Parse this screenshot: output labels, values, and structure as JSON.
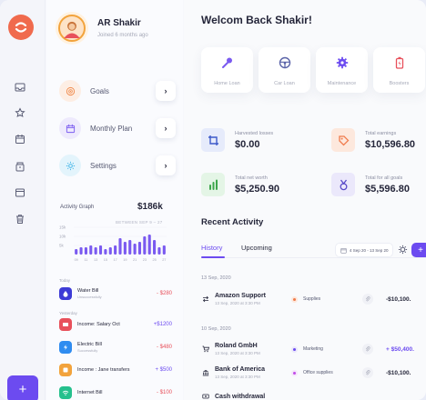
{
  "profile": {
    "name": "AR Shakir",
    "joined": "Joined 6 months ago",
    "avatar_icon": "user-avatar"
  },
  "menu": [
    {
      "label": "Goals",
      "icon": "target-icon",
      "color": "#f08a4b",
      "bg": "#fdeee4"
    },
    {
      "label": "Monthly Plan",
      "icon": "calendar-icon",
      "color": "#7a5af0",
      "bg": "#eeeafd"
    },
    {
      "label": "Settings",
      "icon": "gear-icon",
      "color": "#3fb4e8",
      "bg": "#e3f4fc"
    }
  ],
  "activity_graph": {
    "title": "Activity Graph",
    "value": "$186k",
    "range_label": "BETWEEN SEP 9 – 27"
  },
  "chart_data": {
    "type": "bar",
    "yticks": [
      "15k",
      "10k",
      "5k"
    ],
    "categories": [
      "09",
      "10",
      "11",
      "12",
      "13",
      "14",
      "15",
      "16",
      "17",
      "18",
      "19",
      "20",
      "21",
      "22",
      "23",
      "24",
      "25",
      "26",
      "27"
    ],
    "xticks_shown": [
      "09",
      "11",
      "13",
      "15",
      "17",
      "19",
      "21",
      "23",
      "25",
      "27"
    ],
    "values": [
      3,
      4,
      4,
      5,
      4,
      5,
      3,
      4,
      5,
      9,
      7,
      8,
      6,
      7,
      10,
      11,
      8,
      4,
      5
    ],
    "color": "#7a5af0"
  },
  "side_sections": {
    "today": "Today",
    "yesterday": "Yesterday"
  },
  "side_transactions": [
    {
      "name": "Water Bill",
      "sub": "Unsuccessfully",
      "amount": "- $280",
      "icon": "water-drop-icon",
      "icon_bg": "#3d3bd6",
      "amount_color": "#e8505b"
    },
    {
      "name": "Income: Salary Oct",
      "sub": "",
      "amount": "+$1200",
      "icon": "salary-icon",
      "icon_bg": "#e8505b",
      "amount_color": "#6c4bf0"
    },
    {
      "name": "Electric Bill",
      "sub": "Successfully",
      "amount": "- $480",
      "icon": "lightning-icon",
      "icon_bg": "#2f8cf0",
      "amount_color": "#e8505b"
    },
    {
      "name": "Income : Jane transfers",
      "sub": "",
      "amount": "+ $500",
      "icon": "transfer-icon",
      "icon_bg": "#f2a33c",
      "amount_color": "#6c4bf0"
    },
    {
      "name": "Internet Bill",
      "sub": "",
      "amount": "- $100",
      "icon": "wifi-icon",
      "icon_bg": "#25c08d",
      "amount_color": "#e8505b"
    }
  ],
  "main": {
    "welcome": "Welcom Back Shakir!",
    "quick_actions": [
      {
        "label": "Home Loan",
        "icon": "microphone-icon",
        "color": "#7a5af0"
      },
      {
        "label": "Car Loan",
        "icon": "steering-wheel-icon",
        "color": "#5a63a8"
      },
      {
        "label": "Maintenance",
        "icon": "gear-icon",
        "color": "#6c4bf0"
      },
      {
        "label": "Boosters",
        "icon": "battery-icon",
        "color": "#e8505b"
      }
    ],
    "stats": [
      {
        "label": "Harvested losses",
        "value": "$0.00",
        "icon": "crop-icon",
        "color": "#3d5ac9",
        "bg": "#e6ebfb"
      },
      {
        "label": "Total earnings",
        "value": "$10,596.80",
        "icon": "tag-icon",
        "color": "#f07a4b",
        "bg": "#fde8dd"
      },
      {
        "label": "Total net worth",
        "value": "$5,250.90",
        "icon": "bar-chart-icon",
        "color": "#3ca64a",
        "bg": "#e4f5e6"
      },
      {
        "label": "Total for all goals",
        "value": "$5,596.80",
        "icon": "medal-icon",
        "color": "#5a4bc9",
        "bg": "#ebe8fb"
      }
    ],
    "recent_activity": {
      "title": "Recent Activity",
      "tabs": [
        "History",
        "Upcoming"
      ],
      "date_range": "4 Sep 20 - 13 Sep 20",
      "add_label": "+",
      "groups": [
        {
          "date": "13 Sep, 2020",
          "rows": [
            {
              "name": "Amazon Support",
              "sub": "13 Sep, 2020 at 3:30 PM",
              "category": "Supplies",
              "cat_color": "#f07a4b",
              "amount": "-$10,100.",
              "amount_color": "#25263a",
              "icon": "transfer-arrows-icon"
            }
          ]
        },
        {
          "date": "10 Sep, 2020",
          "rows": [
            {
              "name": "Roland GmbH",
              "sub": "13 Sep, 2020 at 3:30 PM",
              "category": "Marketing",
              "cat_color": "#6c4bf0",
              "amount": "+ $50,400.",
              "amount_color": "#6c4bf0",
              "icon": "cart-icon"
            },
            {
              "name": "Bank of America",
              "sub": "13 Sep, 2020 at 3:30 PM",
              "category": "Office supplies",
              "cat_color": "#c04be8",
              "amount": "-$10,100.",
              "amount_color": "#25263a",
              "icon": "bank-icon"
            },
            {
              "name": "Cash withdrawal",
              "sub": "",
              "category": "",
              "cat_color": "#3fb4e8",
              "amount": "",
              "amount_color": "#25263a",
              "icon": "cash-icon"
            }
          ]
        }
      ]
    }
  },
  "fab_label": "+"
}
